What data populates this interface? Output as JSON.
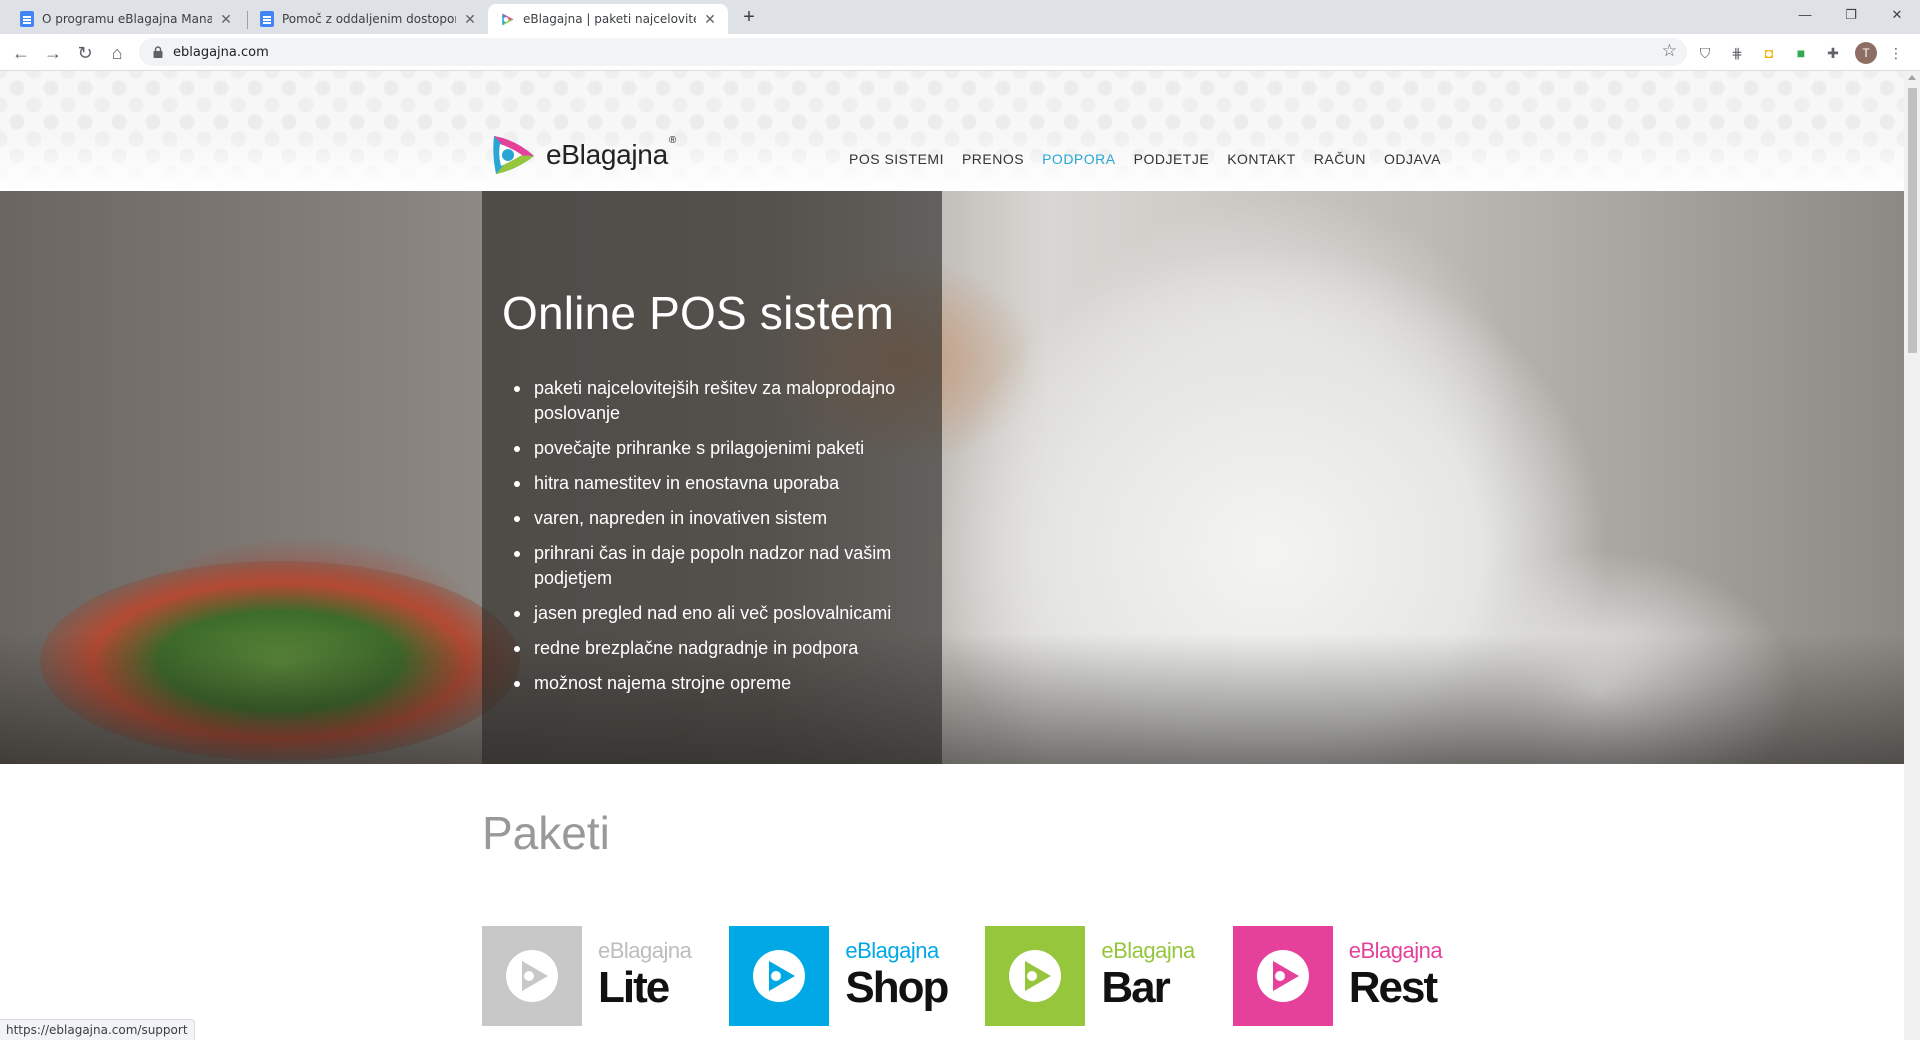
{
  "browser": {
    "tabs": [
      {
        "title": "O programu eBlagajna Manager",
        "icon": "docs-icon",
        "active": false
      },
      {
        "title": "Pomoč z oddaljenim dostopom -",
        "icon": "docs-icon",
        "active": false
      },
      {
        "title": "eBlagajna | paketi najcelovitejših",
        "icon": "eblagajna-favicon",
        "active": true
      }
    ],
    "new_tab": "+",
    "window_controls": {
      "minimize": "—",
      "restore": "❐",
      "close": "✕"
    },
    "address": "eblagajna.com",
    "profile_initial": "T",
    "status_url": "https://eblagajna.com/support"
  },
  "site": {
    "logo_text": "eBlagajna",
    "logo_reg": "®",
    "nav": [
      {
        "label": "POS SISTEMI",
        "active": false
      },
      {
        "label": "PRENOS",
        "active": false
      },
      {
        "label": "PODPORA",
        "active": true
      },
      {
        "label": "PODJETJE",
        "active": false
      },
      {
        "label": "KONTAKT",
        "active": false
      },
      {
        "label": "RAČUN",
        "active": false
      },
      {
        "label": "ODJAVA",
        "active": false
      }
    ],
    "hero": {
      "title": "Online POS sistem",
      "bullets": [
        "paketi najcelovitejših rešitev za maloprodajno poslovanje",
        "povečajte prihranke s prilagojenimi paketi",
        "hitra namestitev in enostavna uporaba",
        "varen, napreden in inovativen sistem",
        "prihrani čas in daje popoln nadzor nad vašim podjetjem",
        "jasen pregled nad eno ali več poslovalnicami",
        "redne brezplačne nadgradnje in podpora",
        "možnost najema strojne opreme"
      ]
    },
    "packages_title": "Paketi",
    "packages": [
      {
        "brand": "eBlagajna",
        "name": "Lite",
        "color": "#c8c8c8",
        "brand_color": "#bdbdbd"
      },
      {
        "brand": "eBlagajna",
        "name": "Shop",
        "color": "#00a9e6",
        "brand_color": "#00a9e6"
      },
      {
        "brand": "eBlagajna",
        "name": "Bar",
        "color": "#95c63c",
        "brand_color": "#95c63c"
      },
      {
        "brand": "eBlagajna",
        "name": "Rest",
        "color": "#e5409a",
        "brand_color": "#e5409a"
      }
    ]
  }
}
